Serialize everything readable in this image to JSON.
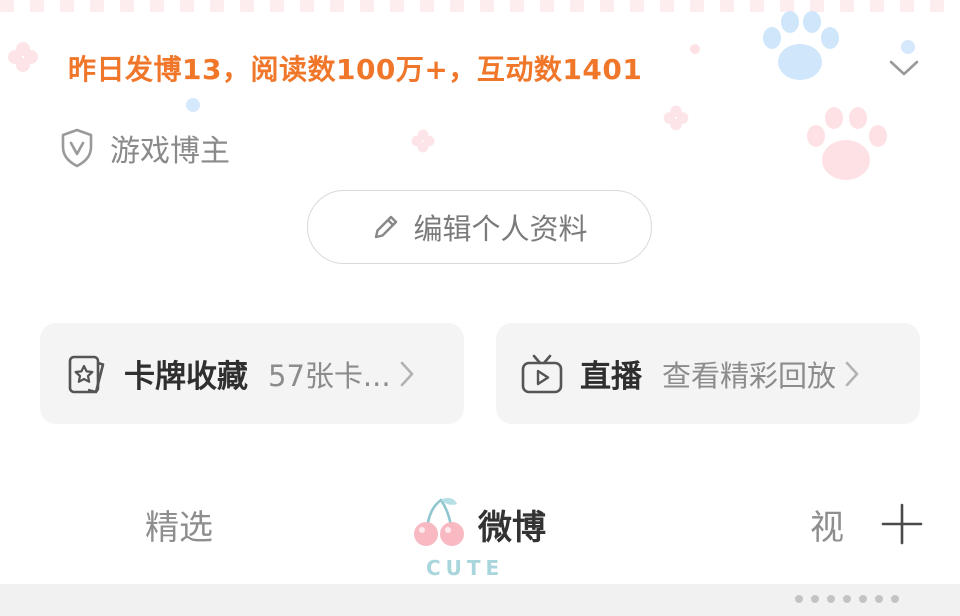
{
  "profile": {
    "stats_line": "昨日发博13，阅读数100万+，互动数1401",
    "verified_label": "游戏博主"
  },
  "actions": {
    "edit_profile_label": "编辑个人资料"
  },
  "cards": [
    {
      "title": "卡牌收藏",
      "subtitle": "57张卡...",
      "icon": "card-star-icon"
    },
    {
      "title": "直播",
      "subtitle": "查看精彩回放",
      "icon": "tv-play-icon"
    }
  ],
  "tabs": [
    {
      "label": "精选"
    },
    {
      "label": "微博"
    },
    {
      "label": "视"
    }
  ],
  "active_tab_badge": "CUTE",
  "colors": {
    "stats_orange": "#f0772a",
    "card_bg": "#f4f4f4",
    "muted_text": "#8c8c8c"
  }
}
